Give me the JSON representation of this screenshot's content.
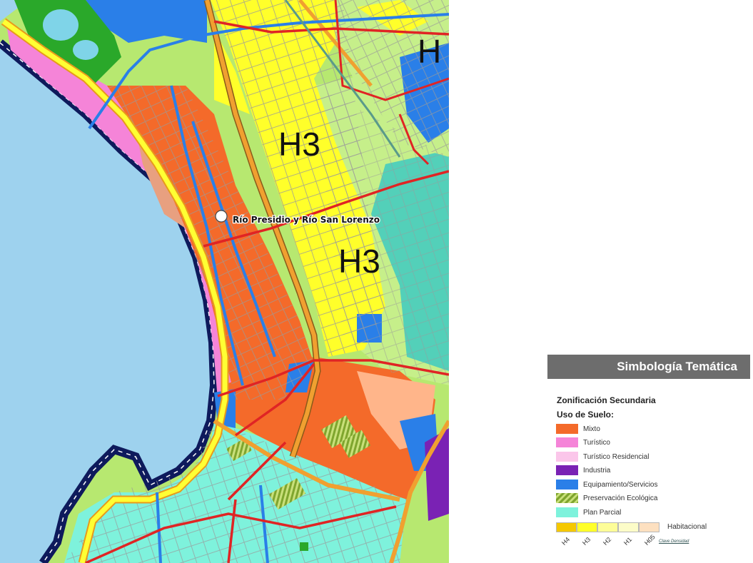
{
  "map": {
    "zones": [
      "H3",
      "H3",
      "H"
    ],
    "poi": {
      "label": "Río Presidio y Río San Lorenzo",
      "icon": "location-marker-icon"
    }
  },
  "legend": {
    "title": "Simbología Temática",
    "section": "Zonificación Secundaria",
    "subsection": "Uso de Suelo:",
    "items": [
      {
        "label": "Mixto",
        "color": "#f46a2a"
      },
      {
        "label": "Turístico",
        "color": "#f584d8"
      },
      {
        "label": "Turístico Residencial",
        "color": "#fbc6ea"
      },
      {
        "label": "Industria",
        "color": "#7a22b4"
      },
      {
        "label": "Equipamiento/Servicios",
        "color": "#2a7fe8"
      },
      {
        "label": "Preservación Ecológica",
        "color": "#9bc53d"
      },
      {
        "label": "Plan Parcial",
        "color": "#7ef2dc"
      }
    ],
    "habitacional": {
      "label": "Habitacional",
      "levels": [
        "H4",
        "H3",
        "H2",
        "H1",
        "H05"
      ],
      "colors": [
        "#f5c800",
        "#ffff2a",
        "#fdfd98",
        "#fcfcc8",
        "#fde0c0"
      ]
    },
    "density_key": "Clave Densidad"
  },
  "colors": {
    "ocean": "#9ed2ee",
    "mixto": "#f46a2a",
    "green_light": "#b7e870",
    "plan_parcial": "#7ef2dc",
    "road_red": "#e02424",
    "road_orange": "#f0a030",
    "road_blue": "#2a7fe8"
  }
}
